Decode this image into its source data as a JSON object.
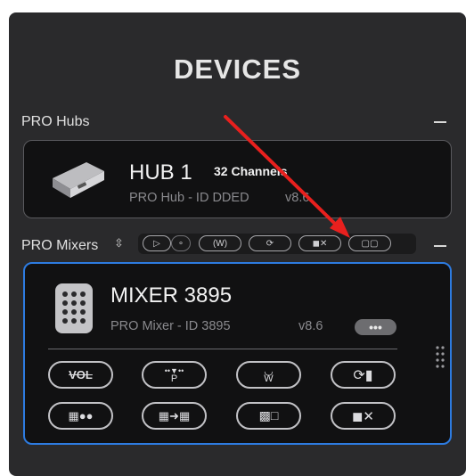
{
  "title": "DEVICES",
  "hubs": {
    "section_label": "PRO Hubs",
    "collapse_icon": "minus-icon",
    "device": {
      "name": "HUB 1",
      "channels": "32 Channels",
      "subtitle": "PRO Hub - ID DDED",
      "version": "v8.6",
      "icon": "hub-device-icon"
    }
  },
  "mixers": {
    "section_label": "PRO Mixers",
    "sort_icon": "sort-updown-icon",
    "collapse_icon": "minus-icon",
    "toolbar": [
      {
        "icon": "play-icon"
      },
      {
        "icon": "pattern-icon"
      },
      {
        "icon": "w-dial-icon",
        "label": "W"
      },
      {
        "icon": "loop-device-icon"
      },
      {
        "icon": "mute-icon"
      },
      {
        "icon": "chat-icon"
      }
    ],
    "device": {
      "name": "MIXER 3895",
      "subtitle": "PRO Mixer - ID 3895",
      "version": "v8.6",
      "more_label": "•••",
      "icon": "mixer-device-icon",
      "buttons": [
        {
          "label": "VOL",
          "icon": "volume-strike-icon"
        },
        {
          "label": "P",
          "icon": "p-dial-icon"
        },
        {
          "label": "W",
          "icon": "w-dial-icon"
        },
        {
          "label": "",
          "icon": "loop-device-icon"
        },
        {
          "label": "",
          "icon": "grid-group-icon"
        },
        {
          "label": "",
          "icon": "transfer-icon"
        },
        {
          "label": "",
          "icon": "chat-icon"
        },
        {
          "label": "",
          "icon": "mute-icon"
        }
      ]
    }
  },
  "accent_color": "#2d7be0",
  "annotation_color": "#e8201e"
}
